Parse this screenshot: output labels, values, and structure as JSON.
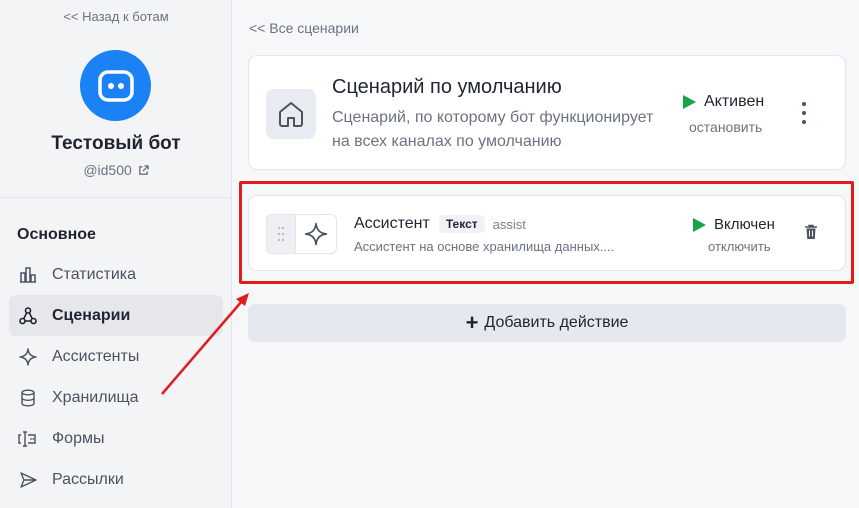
{
  "sidebar": {
    "back_label": "<< Назад к ботам",
    "bot_name": "Тестовый бот",
    "bot_id": "@id500",
    "section_title": "Основное",
    "items": [
      {
        "label": "Статистика",
        "icon": "bar-chart-icon",
        "active": false
      },
      {
        "label": "Сценарии",
        "icon": "sitemap-icon",
        "active": true
      },
      {
        "label": "Ассистенты",
        "icon": "sparkle-icon",
        "active": false
      },
      {
        "label": "Хранилища",
        "icon": "database-icon",
        "active": false
      },
      {
        "label": "Формы",
        "icon": "form-icon",
        "active": false
      },
      {
        "label": "Рассылки",
        "icon": "send-icon",
        "active": false
      }
    ]
  },
  "main": {
    "back_label": "<< Все сценарии",
    "default_card": {
      "title": "Сценарий по умолчанию",
      "description": "Сценарий, по которому бот функционирует на всех каналах по умолчанию",
      "status": "Активен",
      "action": "остановить"
    },
    "assistant_card": {
      "title": "Ассистент",
      "badge": "Текст",
      "tag": "assist",
      "description": "Ассистент на основе хранилища данных....",
      "status": "Включен",
      "action": "отключить"
    },
    "add_button_label": "Добавить действие"
  },
  "colors": {
    "accent": "#1a82f5",
    "status_green": "#16a34a",
    "highlight_red": "#e21b1b"
  }
}
